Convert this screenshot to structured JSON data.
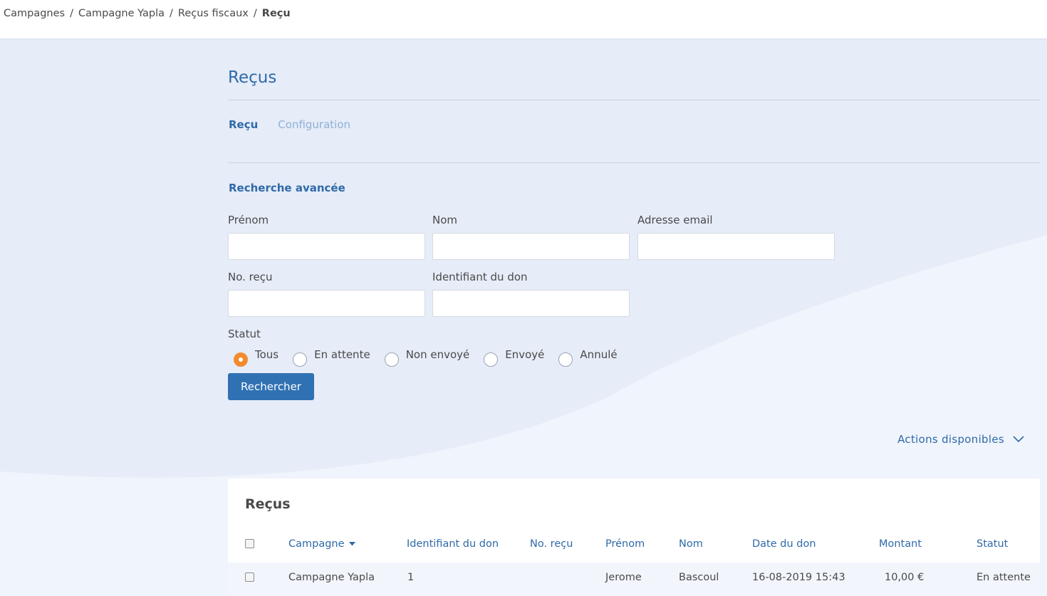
{
  "breadcrumb": {
    "items": [
      "Campagnes",
      "Campagne Yapla",
      "Reçus fiscaux"
    ],
    "current": "Reçu"
  },
  "page": {
    "title": "Reçus",
    "tabs": [
      {
        "label": "Reçu",
        "active": true
      },
      {
        "label": "Configuration",
        "active": false
      }
    ]
  },
  "search": {
    "section_title": "Recherche avancée",
    "fields": {
      "first_name": {
        "label": "Prénom",
        "value": ""
      },
      "last_name": {
        "label": "Nom",
        "value": ""
      },
      "email": {
        "label": "Adresse email",
        "value": ""
      },
      "receipt_no": {
        "label": "No. reçu",
        "value": ""
      },
      "donation_id": {
        "label": "Identifiant du don",
        "value": ""
      }
    },
    "status_label": "Statut",
    "status_options": [
      "Tous",
      "En attente",
      "Non envoyé",
      "Envoyé",
      "Annulé"
    ],
    "status_selected": "Tous",
    "button_label": "Rechercher"
  },
  "actions_label": "Actions disponibles",
  "table": {
    "title": "Reçus",
    "columns": [
      "Campagne",
      "Identifiant du don",
      "No. reçu",
      "Prénom",
      "Nom",
      "Date du don",
      "Montant",
      "Statut"
    ],
    "sort_column": "Campagne",
    "rows": [
      {
        "campagne": "Campagne Yapla",
        "identifiant": "1",
        "no_recu": "",
        "prenom": "Jerome",
        "nom": "Bascoul",
        "date": "16-08-2019 15:43",
        "montant": "10,00 €",
        "statut": "En attente"
      }
    ]
  },
  "colors": {
    "accent": "#2f6aa8",
    "button": "#2f71b3",
    "radio_checked": "#f28b2b",
    "background": "#f0f4fc"
  }
}
